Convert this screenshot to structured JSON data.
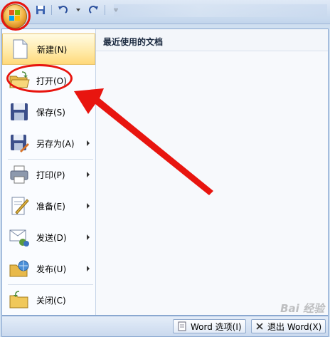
{
  "menu": {
    "items": [
      {
        "label": "新建(N)",
        "icon": "new-document-icon",
        "has_submenu": false
      },
      {
        "label": "打开(O)",
        "icon": "open-folder-icon",
        "has_submenu": false
      },
      {
        "label": "保存(S)",
        "icon": "save-floppy-icon",
        "has_submenu": false
      },
      {
        "label": "另存为(A)",
        "icon": "save-as-icon",
        "has_submenu": true
      },
      {
        "label": "打印(P)",
        "icon": "printer-icon",
        "has_submenu": true
      },
      {
        "label": "准备(E)",
        "icon": "prepare-icon",
        "has_submenu": true
      },
      {
        "label": "发送(D)",
        "icon": "send-icon",
        "has_submenu": true
      },
      {
        "label": "发布(U)",
        "icon": "publish-icon",
        "has_submenu": true
      },
      {
        "label": "关闭(C)",
        "icon": "close-folder-icon",
        "has_submenu": false
      }
    ],
    "active_index": 0
  },
  "recent": {
    "title": "最近使用的文档"
  },
  "footer": {
    "options_label": "Word 选项(I)",
    "exit_label": "退出 Word(X)"
  },
  "watermark": "Bai 经验",
  "colors": {
    "annotation": "#e8150f",
    "accent": "#ffd97a"
  }
}
